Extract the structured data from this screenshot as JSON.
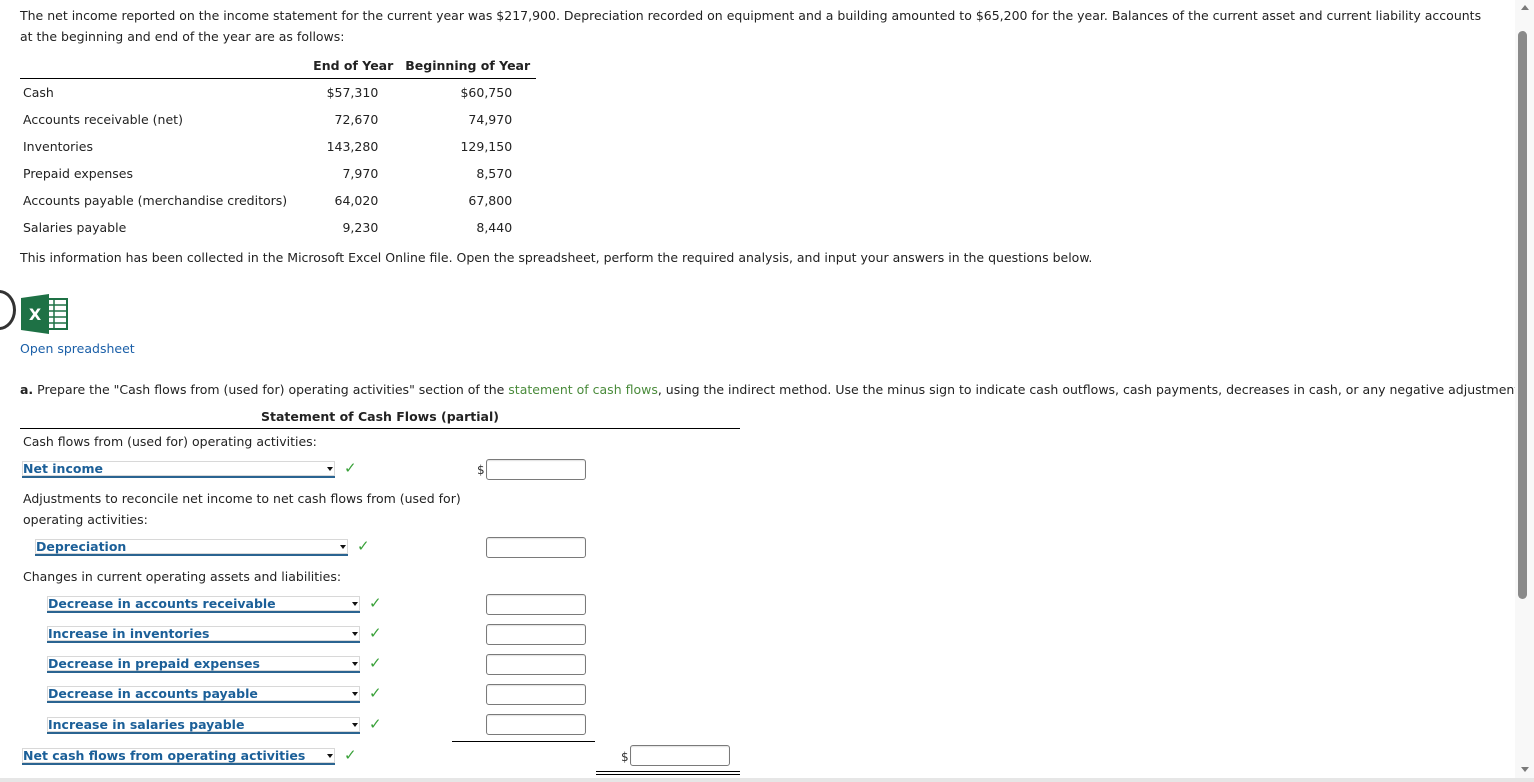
{
  "intro": {
    "text": "The net income reported on the income statement for the current year was $217,900. Depreciation recorded on equipment and a building amounted to $65,200 for the year. Balances of the current asset and current liability accounts at the beginning and end of the year are as follows:"
  },
  "balances": {
    "headers": [
      "",
      "End of Year",
      "Beginning of Year"
    ],
    "rows": [
      {
        "label": "Cash",
        "end": "$57,310",
        "begin": "$60,750"
      },
      {
        "label": "Accounts receivable (net)",
        "end": "72,670",
        "begin": "74,970"
      },
      {
        "label": "Inventories",
        "end": "143,280",
        "begin": "129,150"
      },
      {
        "label": "Prepaid expenses",
        "end": "7,970",
        "begin": "8,570"
      },
      {
        "label": "Accounts payable (merchandise creditors)",
        "end": "64,020",
        "begin": "67,800"
      },
      {
        "label": "Salaries payable",
        "end": "9,230",
        "begin": "8,440"
      }
    ]
  },
  "info_text": "This information has been collected in the Microsoft Excel Online file. Open the spreadsheet, perform the required analysis, and input your answers in the questions below.",
  "spreadsheet": {
    "icon": "excel-icon",
    "link_label": "Open spreadsheet"
  },
  "question": {
    "letter": "a.",
    "text_before": "Prepare the \"Cash flows from (used for) operating activities\" section of the ",
    "link_text": "statement of cash flows",
    "text_after": ", using the indirect method. Use the minus sign to indicate cash outflows, cash payments, decreases in cash, or any negative adjustments."
  },
  "statement": {
    "title": "Statement of Cash Flows (partial)",
    "section_heading": "Cash flows from (used for) operating activities:",
    "adjustments_heading_line1": "Adjustments to reconcile net income to net cash flows from (used for)",
    "adjustments_heading_line2": "operating activities:",
    "changes_heading": "Changes in current operating assets and liabilities:",
    "currency_symbol": "$",
    "check_glyph": "✓",
    "lines": [
      {
        "selected": "Net income",
        "status": "correct",
        "value": ""
      },
      {
        "selected": "Depreciation",
        "status": "correct",
        "value": ""
      },
      {
        "selected": "Decrease in accounts receivable",
        "status": "correct",
        "value": ""
      },
      {
        "selected": "Increase in inventories",
        "status": "correct",
        "value": ""
      },
      {
        "selected": "Decrease in prepaid expenses",
        "status": "correct",
        "value": ""
      },
      {
        "selected": "Decrease in accounts payable",
        "status": "correct",
        "value": ""
      },
      {
        "selected": "Increase in salaries payable",
        "status": "correct",
        "value": ""
      },
      {
        "selected": "Net cash flows from operating activities",
        "status": "correct",
        "value": ""
      }
    ]
  },
  "colors": {
    "link_blue": "#1a5fa8",
    "dropdown_text": "#1b5f98",
    "check_green": "#3aa13a",
    "term_link_green": "#4a8b3b",
    "excel_green": "#1e7145"
  }
}
